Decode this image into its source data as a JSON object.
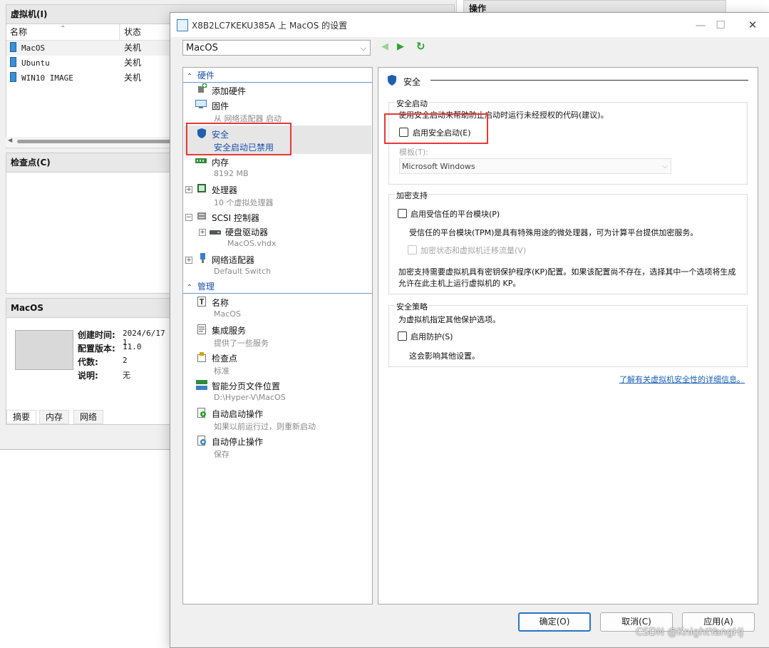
{
  "manager": {
    "vm_panel_title": "虚拟机(I)",
    "col_name": "名称",
    "col_status": "状态",
    "vms": [
      {
        "name": "MacOS",
        "status": "关机"
      },
      {
        "name": "Ubuntu",
        "status": "关机"
      },
      {
        "name": "WIN10 IMAGE",
        "status": "关机"
      }
    ],
    "checkpoint_title": "检查点(C)",
    "details_title": "MacOS",
    "details": [
      {
        "label": "创建时间:",
        "value": "2024/6/17 1"
      },
      {
        "label": "配置版本:",
        "value": "11.0"
      },
      {
        "label": "代数:",
        "value": "2"
      },
      {
        "label": "说明:",
        "value": "无"
      }
    ],
    "details_tabs": [
      "摘要",
      "内存",
      "网络"
    ],
    "actions_title": "操作"
  },
  "dialog": {
    "title": "X8B2LC7KEKU385A 上 MacOS 的设置",
    "vm_select": "MacOS",
    "tree": {
      "hardware_header": "硬件",
      "management_header": "管理",
      "hardware": [
        {
          "label": "添加硬件",
          "sub": ""
        },
        {
          "label": "固件",
          "sub": "从 网络适配器 启动"
        },
        {
          "label": "安全",
          "sub": "安全启动已禁用"
        },
        {
          "label": "内存",
          "sub": "8192 MB"
        },
        {
          "label": "处理器",
          "sub": "10 个虚拟处理器"
        },
        {
          "label": "SCSI 控制器",
          "sub": ""
        },
        {
          "label": "硬盘驱动器",
          "sub": "MacOS.vhdx"
        },
        {
          "label": "网络适配器",
          "sub": "Default Switch"
        }
      ],
      "management": [
        {
          "label": "名称",
          "sub": "MacOS"
        },
        {
          "label": "集成服务",
          "sub": "提供了一些服务"
        },
        {
          "label": "检查点",
          "sub": "标准"
        },
        {
          "label": "智能分页文件位置",
          "sub": "D:\\Hyper-V\\MacOS"
        },
        {
          "label": "自动启动操作",
          "sub": "如果以前运行过，则重新启动"
        },
        {
          "label": "自动停止操作",
          "sub": "保存"
        }
      ]
    },
    "content": {
      "section_title": "安全",
      "secure_boot": {
        "title": "安全启动",
        "desc": "使用安全启动来帮助防止启动时运行未经授权的代码(建议)。",
        "checkbox": "启用安全启动(E)",
        "checked": false,
        "template_label": "模板(T):",
        "template_value": "Microsoft Windows"
      },
      "encryption": {
        "title": "加密支持",
        "tpm_checkbox": "启用受信任的平台模块(P)",
        "tpm_checked": false,
        "tpm_desc": "受信任的平台模块(TPM)是具有特殊用途的微处理器，可为计算平台提供加密服务。",
        "migration_checkbox": "加密状态和虚拟机迁移流量(V)",
        "kp_desc_1": "加密支持需要虚拟机具有密钥保护程序(KP)配置。如果该配置尚不存在，选择其中一个选项将生成",
        "kp_desc_2": "允许在此主机上运行虚拟机的 KP。"
      },
      "policy": {
        "title": "安全策略",
        "desc": "为虚拟机指定其他保护选项。",
        "checkbox": "启用防护(S)",
        "checked": false,
        "note": "这会影响其他设置。"
      },
      "link": "了解有关虚拟机安全性的详细信息。"
    },
    "buttons": {
      "ok": "确定(O)",
      "cancel": "取消(C)",
      "apply": "应用(A)"
    }
  },
  "watermark": "CSDN @KnightYangHJ",
  "colors": {
    "accent": "#2a73c5",
    "highlight": "#e53935",
    "section": "#1b4fa8"
  }
}
